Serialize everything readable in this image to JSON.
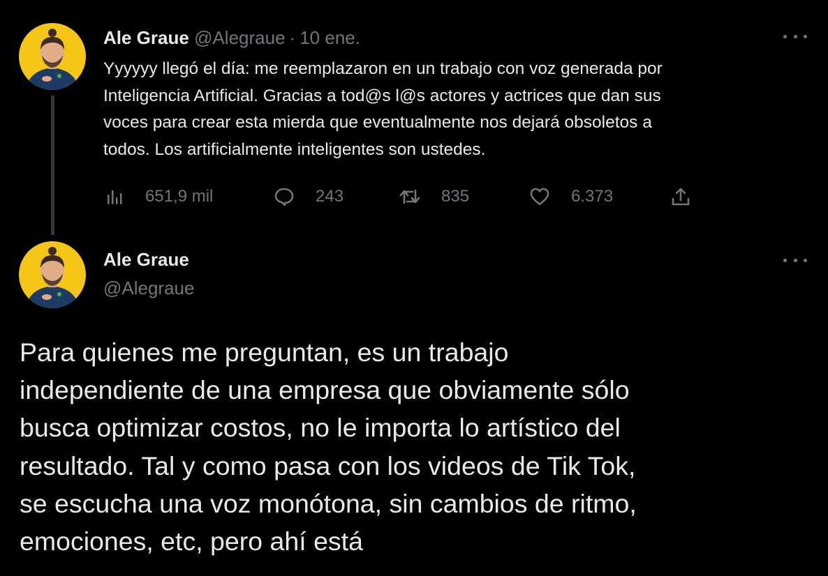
{
  "tweet1": {
    "name": "Ale Graue",
    "handle": "@Alegraue",
    "separator": "·",
    "date": "10 ene.",
    "text": "Yyyyyy llegó el día: me reemplazaron en un trabajo con voz generada por\nInteligencia Artificial. Gracias a tod@s l@s actores y actrices que dan sus\nvoces para crear esta mierda que eventualmente nos dejará obsoletos a\ntodos. Los artificialmente inteligentes son ustedes.",
    "stats": {
      "views": "651,9 mil",
      "replies": "243",
      "retweets": "835",
      "likes": "6.373"
    },
    "icons": [
      "views-icon",
      "reply-icon",
      "retweet-icon",
      "like-icon",
      "share-icon",
      "more-icon"
    ]
  },
  "tweet2": {
    "name": "Ale Graue",
    "handle": "@Alegraue",
    "text": "Para quienes me preguntan, es un trabajo\nindependiente de una empresa que obviamente sólo\nbusca optimizar costos, no le importa lo artístico del\nresultado. Tal y como pasa con los videos de Tik Tok,\nse escucha una voz monótona, sin cambios de ritmo,\nemociones, etc, pero ahí está"
  },
  "colors": {
    "background": "#000000",
    "primary_text": "#e7e9ea",
    "secondary_text": "#71767b",
    "thread_line": "#333639",
    "avatar_background": "#f5c518"
  }
}
